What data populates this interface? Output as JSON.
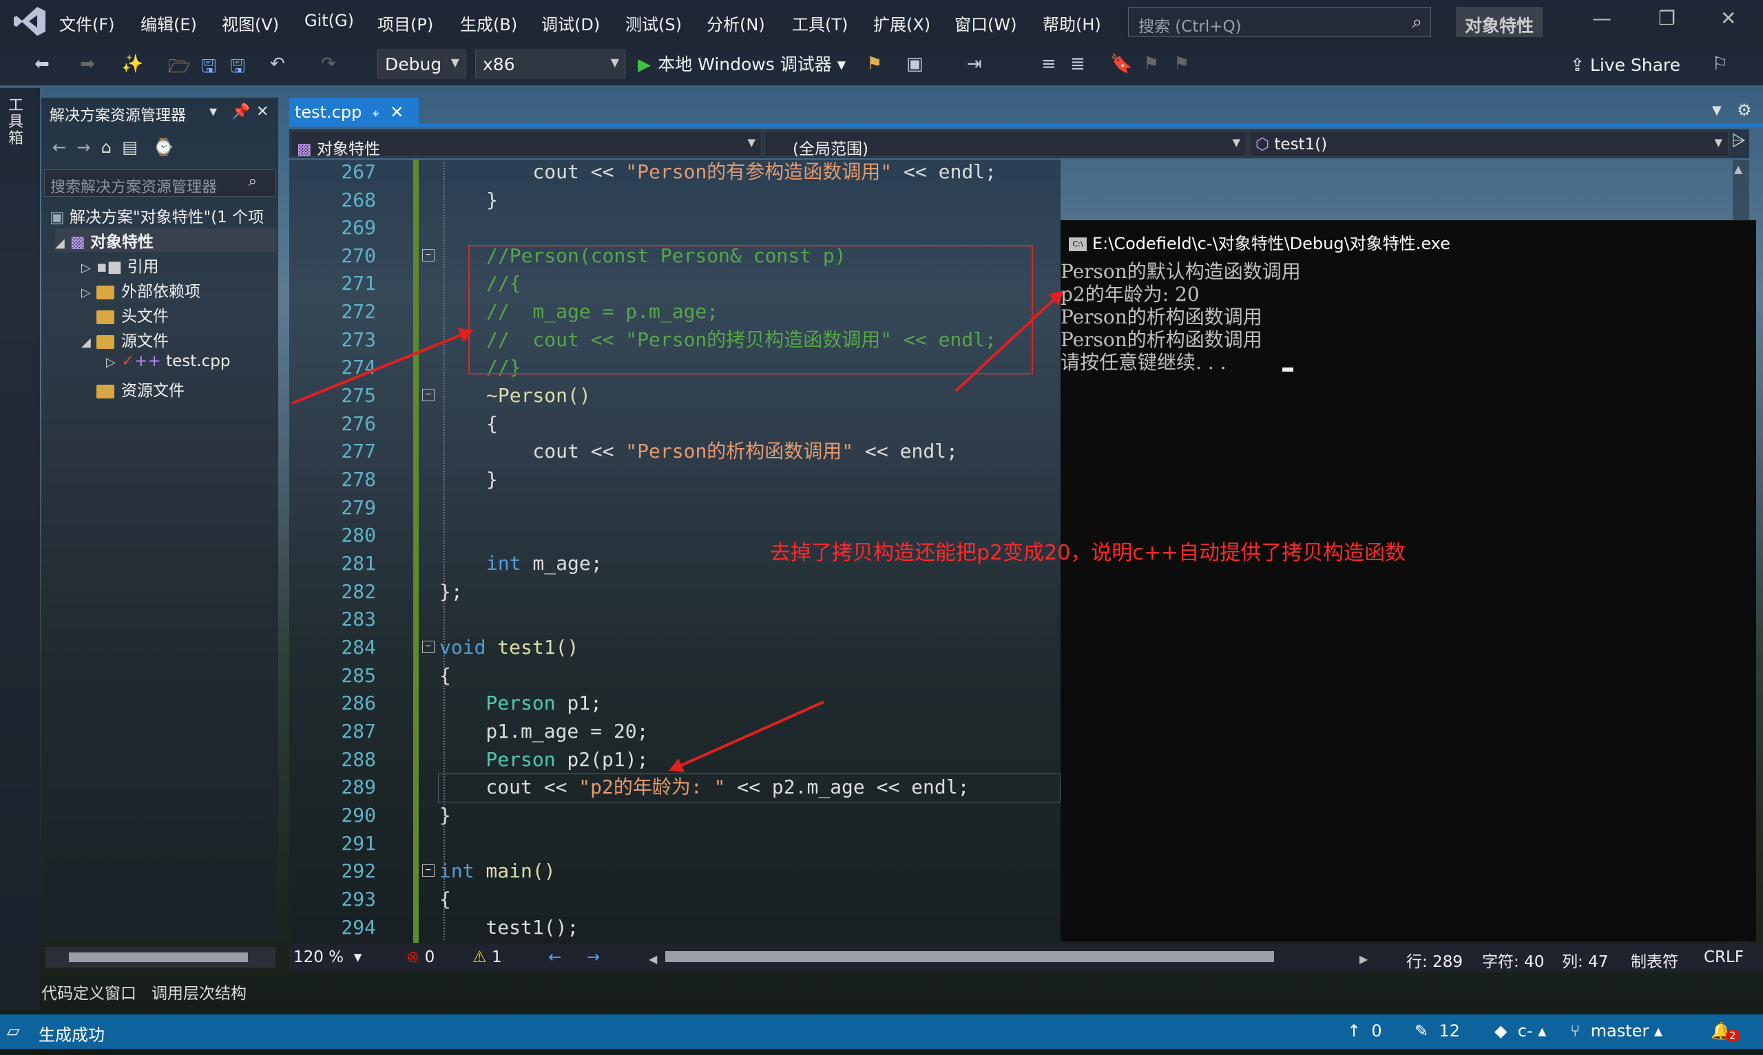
{
  "menubar": {
    "items": [
      "文件(F)",
      "编辑(E)",
      "视图(V)",
      "Git(G)",
      "项目(P)",
      "生成(B)",
      "调试(D)",
      "测试(S)",
      "分析(N)",
      "工具(T)",
      "扩展(X)",
      "窗口(W)",
      "帮助(H)"
    ],
    "search_placeholder": "搜索 (Ctrl+Q)",
    "project_badge": "对象特性"
  },
  "toolbar": {
    "config": "Debug",
    "platform": "x86",
    "run_label": "本地 Windows 调试器",
    "live_share": "Live Share"
  },
  "toolbox_label": "工具箱",
  "solution_explorer": {
    "title": "解决方案资源管理器",
    "search_placeholder": "搜索解决方案资源管理器",
    "tree": {
      "solution": "解决方案\"对象特性\"(1 个项",
      "project": "对象特性",
      "references": "引用",
      "external_deps": "外部依赖项",
      "headers": "头文件",
      "sources": "源文件",
      "file": "test.cpp",
      "resources": "资源文件"
    }
  },
  "bottom_tabs": [
    "代码定义窗口",
    "调用层次结构"
  ],
  "editor": {
    "tab": "test.cpp",
    "nav_scope": "对象特性",
    "nav_global": "(全局范围)",
    "nav_func": "test1()",
    "lines": [
      "267",
      "268",
      "269",
      "270",
      "271",
      "272",
      "273",
      "274",
      "275",
      "276",
      "277",
      "278",
      "279",
      "280",
      "281",
      "282",
      "283",
      "284",
      "285",
      "286",
      "287",
      "288",
      "289",
      "290",
      "291",
      "292",
      "293",
      "294"
    ],
    "code": {
      "l267a": "    cout << ",
      "l267b": "\"Person的有参构造函数调用\"",
      "l267c": " << endl;",
      "l268": "}",
      "l270": "//Person(const Person& const p)",
      "l271": "//{",
      "l272": "//  m_age = p.m_age;",
      "l273": "//  cout << \"Person的拷贝构造函数调用\" << endl;",
      "l274": "//}",
      "l275": "~Person()",
      "l276": "{",
      "l277a": "    cout << ",
      "l277b": "\"Person的析构函数调用\"",
      "l277c": " << endl;",
      "l278": "}",
      "l281a": "int",
      "l281b": " m_age;",
      "l282": "};",
      "l284a": "void",
      "l284b": " test1()",
      "l285": "{",
      "l286a": "    Person",
      "l286b": " p1;",
      "l287": "    p1.m_age = 20;",
      "l288a": "    Person",
      "l288b": " p2(p1);",
      "l289a": "    cout << ",
      "l289b": "\"p2的年龄为: \"",
      "l289c": " << p2.m_age << endl;",
      "l290": "}",
      "l292a": "int",
      "l292b": " main()",
      "l293": "{",
      "l294": "    test1();"
    },
    "zoom": "120 %",
    "errors": "0",
    "warnings": "1",
    "row": "行: 289",
    "char": "字符: 40",
    "col": "列: 47",
    "tabs": "制表符",
    "eol": "CRLF"
  },
  "console": {
    "title": "E:\\Codefield\\c-\\对象特性\\Debug\\对象特性.exe",
    "lines": [
      "Person的默认构造函数调用",
      "p2的年龄为: 20",
      "Person的析构函数调用",
      "Person的析构函数调用",
      "请按任意键继续. . ."
    ]
  },
  "annotation": "去掉了拷贝构造还能把p2变成20，说明c++自动提供了拷贝构造函数",
  "statusbar": {
    "build": "生成成功",
    "up": "0",
    "edits": "12",
    "repo": "c-",
    "branch": "master",
    "notifications": "2"
  }
}
